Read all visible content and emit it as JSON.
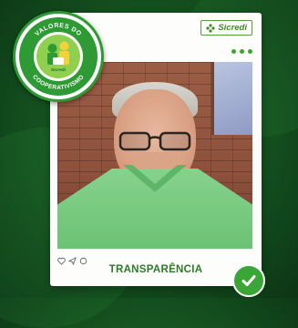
{
  "brand": {
    "name": "Sicredi",
    "icon": "sicredi-logo-icon"
  },
  "badge": {
    "top_text": "VALORES DO",
    "bottom_text": "COOPERATIVISMO",
    "inner_brand": "Sicredi",
    "icon": "cooperativism-illustration-icon"
  },
  "post": {
    "caption": "TRANSPARÊNCIA",
    "menu_icon": "more-dots-icon",
    "action_icons": [
      "heart-icon",
      "send-icon",
      "comment-icon"
    ]
  },
  "status_icon": "check-circle-icon",
  "colors": {
    "background": "#14501f",
    "brand_green": "#3ea52c",
    "caption_green": "#2d7a2b",
    "card": "#fdfdfb"
  }
}
